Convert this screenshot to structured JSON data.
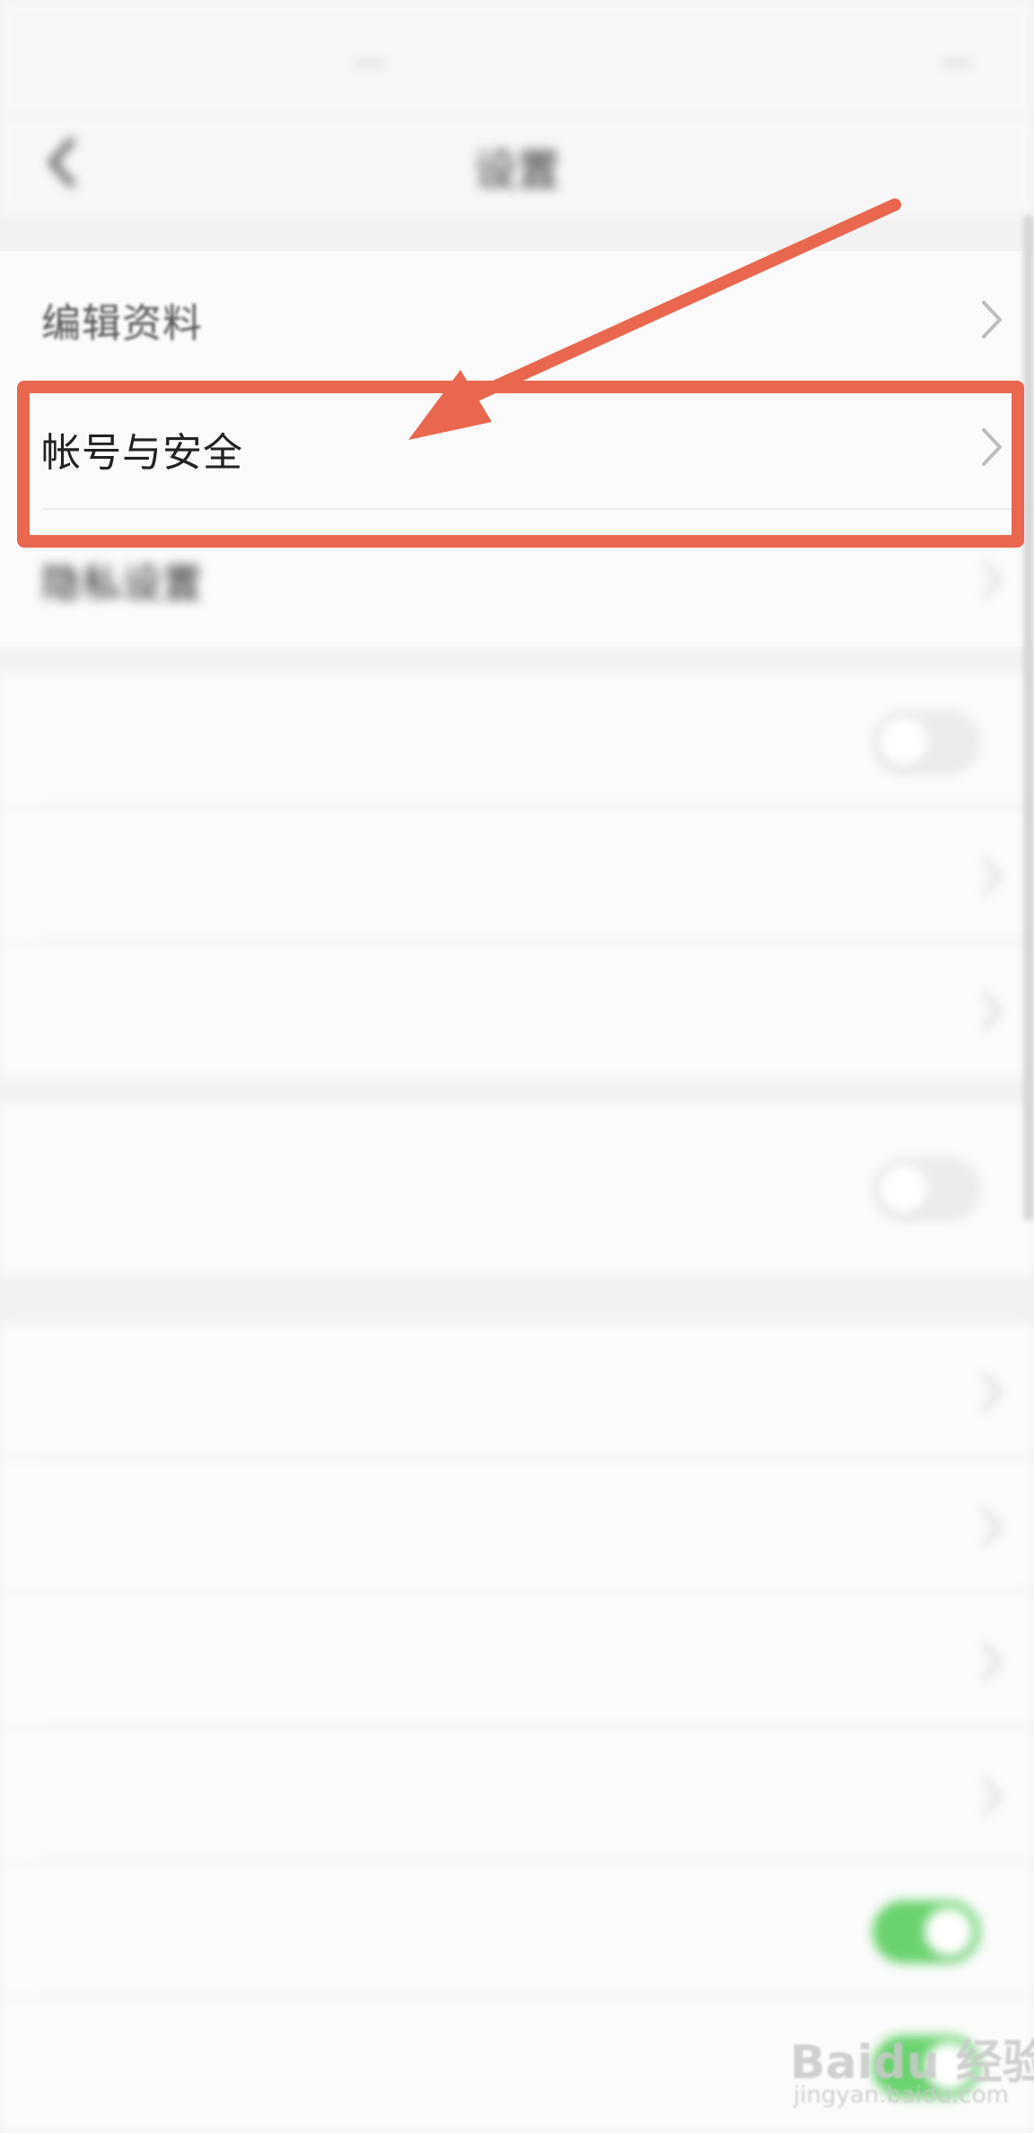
{
  "status_bar": {
    "left_text": "...",
    "right_text": "..."
  },
  "nav": {
    "title": "设置",
    "back_icon": "back-chevron-icon"
  },
  "section1": {
    "rows": [
      {
        "label": "编辑资料",
        "icon": "chevron-right-icon"
      },
      {
        "label": "帐号与安全",
        "icon": "chevron-right-icon",
        "highlighted": true
      },
      {
        "label": "隐私设置",
        "icon": "chevron-right-icon"
      }
    ]
  },
  "section2": {
    "rows": [
      {
        "label": "",
        "control": "toggle-off"
      },
      {
        "label": "",
        "control": "chevron"
      },
      {
        "label": "",
        "value": "",
        "control": "chevron"
      }
    ]
  },
  "section3": {
    "row": {
      "label": "",
      "subtext": "",
      "control": "toggle-off"
    }
  },
  "section4": {
    "rows": [
      {
        "label": "",
        "value": "",
        "control": "chevron"
      },
      {
        "label": "",
        "control": "chevron"
      },
      {
        "label": "",
        "control": "chevron"
      },
      {
        "label": "",
        "control": "chevron"
      },
      {
        "label": "",
        "control": "toggle-on"
      },
      {
        "label": "",
        "control": "toggle-on"
      }
    ]
  },
  "annotation": {
    "highlight_color": "#e8674e",
    "arrow_color": "#e8674e"
  },
  "watermark": {
    "main": "Baidu 经验",
    "sub": "jingyan.baidu.com"
  },
  "colors": {
    "background": "#f2f2f2",
    "row_bg": "#fbfbfb",
    "toggle_on": "#6ad36f",
    "divider": "#e7e7e7"
  }
}
